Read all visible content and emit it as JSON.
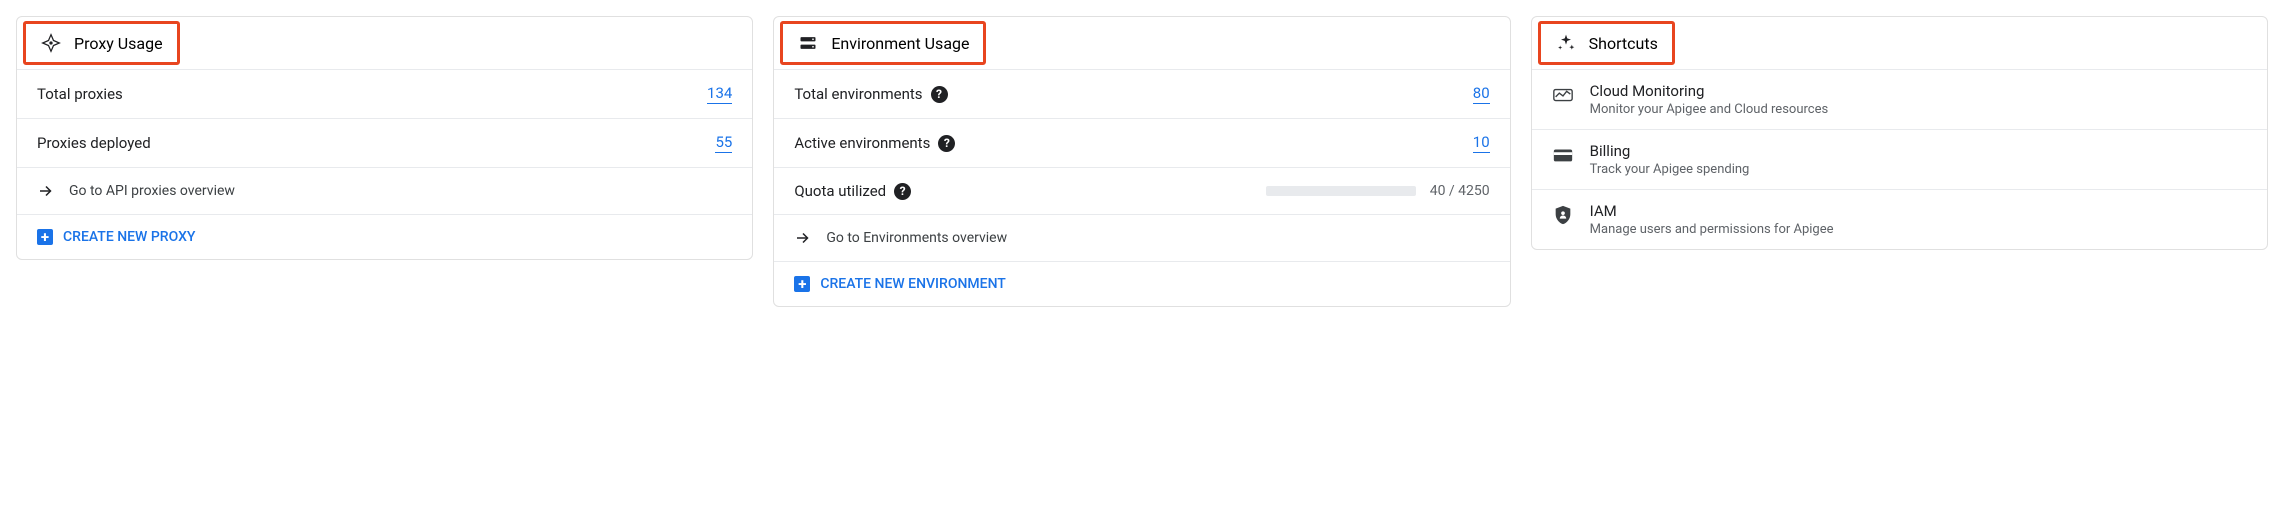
{
  "proxy_usage": {
    "title": "Proxy Usage",
    "rows": [
      {
        "label": "Total proxies",
        "value": "134"
      },
      {
        "label": "Proxies deployed",
        "value": "55"
      }
    ],
    "nav_label": "Go to API proxies overview",
    "create_label": "CREATE NEW PROXY"
  },
  "environment_usage": {
    "title": "Environment Usage",
    "rows": [
      {
        "label": "Total environments",
        "value": "80",
        "help": true
      },
      {
        "label": "Active environments",
        "value": "10",
        "help": true
      }
    ],
    "quota": {
      "label": "Quota utilized",
      "used": 40,
      "total": 4250,
      "text": "40 / 4250",
      "percent": 0.94
    },
    "nav_label": "Go to Environments overview",
    "create_label": "CREATE NEW ENVIRONMENT"
  },
  "shortcuts": {
    "title": "Shortcuts",
    "items": [
      {
        "title": "Cloud Monitoring",
        "desc": "Monitor your Apigee and Cloud resources",
        "icon": "monitoring"
      },
      {
        "title": "Billing",
        "desc": "Track your Apigee spending",
        "icon": "billing"
      },
      {
        "title": "IAM",
        "desc": "Manage users and permissions for Apigee",
        "icon": "iam"
      }
    ]
  }
}
